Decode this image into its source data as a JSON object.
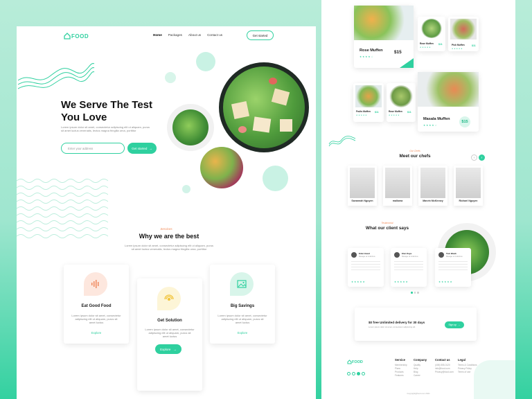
{
  "brand": {
    "logo": "FOOD",
    "accent": "#2fd09f",
    "accent_dark": "#1fb886"
  },
  "nav": {
    "items": [
      "Home",
      "Packages",
      "About us",
      "Contact us"
    ],
    "cta": "Get started"
  },
  "hero": {
    "title_line1": "We Serve The Test",
    "title_line2": "You Love",
    "subtitle_line1": "Lorem ipsum dolor sit amet, consectetur adipiscing elit ut aliquam, purus",
    "subtitle_line2": "sit amet luctus venenatis, lectus magna fringilla urna, porttitor",
    "address_placeholder": "Enter your address",
    "cta": "Get started"
  },
  "why": {
    "kicker": "Services",
    "title": "Why we are the best",
    "desc_line1": "Lorem ipsum dolor sit amet, consectetur adipiscing elit ut aliquam, purus",
    "desc_line2": "sit amet luctus venenatis, lectus magna fringilla urna, porttitor",
    "cards": [
      {
        "title": "Eat Good Food",
        "text1": "Lorem ipsum dolor sit amet, consectetur",
        "text2": "adipiscing elit ut aliquam, purus sit",
        "text3": "amet luctus",
        "link": "Explore",
        "icon": "sound-wave-icon"
      },
      {
        "title": "Get Solution",
        "text1": "Lorem ipsum dolor sit amet, consectetur",
        "text2": "adipiscing elit ut aliquam, purus sit",
        "text3": "amet luctus",
        "link": "Explore",
        "icon": "signal-icon"
      },
      {
        "title": "Big Savings",
        "text1": "Lorem ipsum dolor sit amet, consectetur",
        "text2": "adipiscing elit ut aliquam, purus sit",
        "text3": "amet luctus",
        "link": "Explore",
        "icon": "image-icon"
      }
    ]
  },
  "menu": {
    "large": [
      {
        "name": "Rose Muffen",
        "price": "$15",
        "stars": "★★★★☆"
      },
      {
        "name": "Masala Muffen",
        "price": "$15",
        "stars": "★★★★☆"
      }
    ],
    "small": [
      {
        "name": "Rose Muffen",
        "price": "$11",
        "stars": "★★★★★"
      },
      {
        "name": "Pish Muffen",
        "price": "$11",
        "stars": "★★★★★"
      },
      {
        "name": "Fruits Muffen",
        "price": "$11",
        "stars": "★★★★★"
      },
      {
        "name": "Rose Muffen",
        "price": "$11",
        "stars": "★★★★★"
      }
    ]
  },
  "chefs": {
    "kicker": "Our Chefs",
    "title": "Meet our chefs",
    "list": [
      "Savannah Nguyen",
      "malloma",
      "Marvin McKinney",
      "Richael Nguyen"
    ]
  },
  "testimonials": {
    "kicker": "Testimonial",
    "title": "What our client says",
    "list": [
      {
        "name": "Eden Hazel",
        "role": "Manager at Columbus"
      },
      {
        "name": "Elen Kaye",
        "role": "Manager at Columbus"
      },
      {
        "name": "Tom Black",
        "role": "Manager at Columbus"
      }
    ]
  },
  "promo": {
    "title": "$0 free Unlimited delivery for 30 days",
    "subtitle": "Lorem ipsum dolor sit amet, consectetur adipiscing elit",
    "cta": "Sign up"
  },
  "footer": {
    "logo": "FOOD",
    "columns": [
      {
        "title": "Service",
        "links": [
          "Membership",
          "Plans",
          "Products",
          "Features"
        ]
      },
      {
        "title": "Company",
        "links": [
          "Quality",
          "Help",
          "Blog",
          "Career"
        ]
      },
      {
        "title": "Contact us",
        "links": [
          "(406) 555-0120",
          "info@food.com",
          "Privacy@food.com"
        ]
      },
      {
        "title": "Legal",
        "links": [
          "Terms & Conditions",
          "Privacy Policy",
          "Terms of use"
        ]
      }
    ],
    "copyright": "Copyright@food.com 2021"
  }
}
